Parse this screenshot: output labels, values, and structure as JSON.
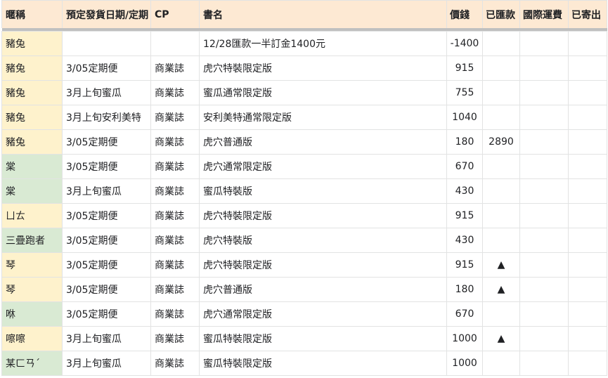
{
  "columns": {
    "nick": "暱稱",
    "date": "預定發貨日期/定期",
    "cp": "CP",
    "title": "書名",
    "price": "價錢",
    "paid": "已匯款",
    "shipping": "國際運費",
    "sent": "已寄出"
  },
  "colors": {
    "header_bg": "#fde9d3",
    "nick_yellow": "#fef2cc",
    "nick_green": "#d9ead3",
    "grid": "#e2e3e3"
  },
  "rows": [
    {
      "nick": "豬兔",
      "tone": "yellow",
      "date": "",
      "cp": "",
      "title": "12/28匯款一半訂金1400元",
      "price": "-1400",
      "paid": "",
      "shipping": "",
      "sent": ""
    },
    {
      "nick": "豬兔",
      "tone": "yellow",
      "date": "3/05定期便",
      "cp": "商業誌",
      "title": "虎穴特裝限定版",
      "price": "915",
      "paid": "",
      "shipping": "",
      "sent": ""
    },
    {
      "nick": "豬兔",
      "tone": "yellow",
      "date": "3月上旬蜜瓜",
      "cp": "商業誌",
      "title": "蜜瓜通常限定版",
      "price": "755",
      "paid": "",
      "shipping": "",
      "sent": ""
    },
    {
      "nick": "豬兔",
      "tone": "yellow",
      "date": "3月上旬安利美特",
      "cp": "商業誌",
      "title": "安利美特通常限定版",
      "price": "1040",
      "paid": "",
      "shipping": "",
      "sent": ""
    },
    {
      "nick": "豬兔",
      "tone": "yellow",
      "date": "3/05定期便",
      "cp": "商業誌",
      "title": "虎穴普通版",
      "price": "180",
      "paid": "2890",
      "shipping": "",
      "sent": ""
    },
    {
      "nick": "棠",
      "tone": "green",
      "date": "3/05定期便",
      "cp": "商業誌",
      "title": "虎穴通常限定版",
      "price": "670",
      "paid": "",
      "shipping": "",
      "sent": ""
    },
    {
      "nick": "棠",
      "tone": "green",
      "date": "3月上旬蜜瓜",
      "cp": "商業誌",
      "title": "蜜瓜特裝版",
      "price": "430",
      "paid": "",
      "shipping": "",
      "sent": ""
    },
    {
      "nick": "ㄩㄊ",
      "tone": "yellow",
      "date": "3/05定期便",
      "cp": "商業誌",
      "title": "虎穴特裝限定版",
      "price": "915",
      "paid": "",
      "shipping": "",
      "sent": ""
    },
    {
      "nick": "三疊跑者",
      "tone": "green",
      "date": "3/05定期便",
      "cp": "商業誌",
      "title": "虎穴特裝版",
      "price": "430",
      "paid": "",
      "shipping": "",
      "sent": ""
    },
    {
      "nick": "琴",
      "tone": "yellow",
      "date": "3/05定期便",
      "cp": "商業誌",
      "title": "虎穴特裝限定版",
      "price": "915",
      "paid": "▲",
      "shipping": "",
      "sent": ""
    },
    {
      "nick": "琴",
      "tone": "yellow",
      "date": "3/05定期便",
      "cp": "商業誌",
      "title": "虎穴普通版",
      "price": "180",
      "paid": "▲",
      "shipping": "",
      "sent": ""
    },
    {
      "nick": "咻",
      "tone": "green",
      "date": "3/05定期便",
      "cp": "商業誌",
      "title": "虎穴通常限定版",
      "price": "670",
      "paid": "",
      "shipping": "",
      "sent": ""
    },
    {
      "nick": "嚓嚓",
      "tone": "yellow",
      "date": "3月上旬蜜瓜",
      "cp": "商業誌",
      "title": "蜜瓜特裝限定版",
      "price": "1000",
      "paid": "▲",
      "shipping": "",
      "sent": ""
    },
    {
      "nick": "某ㄈㄢˊ",
      "tone": "green",
      "date": "3月上旬蜜瓜",
      "cp": "商業誌",
      "title": "蜜瓜特裝限定版",
      "price": "1000",
      "paid": "",
      "shipping": "",
      "sent": ""
    }
  ]
}
